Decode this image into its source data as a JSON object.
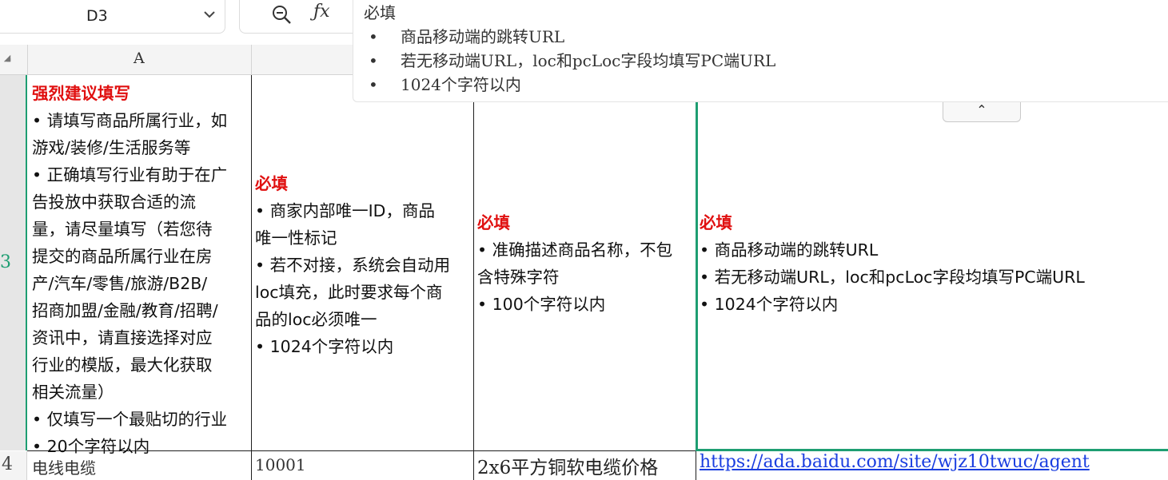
{
  "name_box": {
    "value": "D3"
  },
  "formula_bar": {
    "title": "必填",
    "bullets": [
      "商品移动端的跳转URL",
      "若无移动端URL，loc和pcLoc字段均填写PC端URL",
      "1024个字符以内"
    ],
    "collapse_glyph": "⌃"
  },
  "columns": {
    "a_label": "A"
  },
  "rows": {
    "row3_label": "3",
    "row4_label": "4"
  },
  "row3": {
    "a": {
      "title": "强烈建议填写",
      "lines": [
        "• 请填写商品所属行业，如",
        "游戏/装修/生活服务等",
        "• 正确填写行业有助于在广",
        "告投放中获取合适的流",
        "量，请尽量填写（若您待",
        "提交的商品所属行业在房",
        "产/汽车/零售/旅游/B2B/",
        "招商加盟/金融/教育/招聘/",
        "资讯中，请直接选择对应",
        "行业的模版，最大化获取",
        "相关流量）",
        "• 仅填写一个最贴切的行业",
        "• 20个字符以内"
      ]
    },
    "b": {
      "title": "必填",
      "lines": [
        "• 商家内部唯一ID，商品",
        "唯一性标记",
        "• 若不对接，系统会自动用",
        "loc填充，此时要求每个商",
        "品的loc必须唯一",
        "• 1024个字符以内"
      ]
    },
    "c": {
      "title": "必填",
      "lines": [
        "• 准确描述商品名称，不包",
        "含特殊字符",
        "• 100个字符以内"
      ]
    },
    "d": {
      "title": "必填",
      "lines": [
        "• 商品移动端的跳转URL",
        "• 若无移动端URL，loc和pcLoc字段均填写PC端URL",
        "• 1024个字符以内"
      ]
    }
  },
  "row4": {
    "a": "电线电缆",
    "b": "10001",
    "c": "2x6平方铜软电缆价格",
    "d": "https://ada.baidu.com/site/wjz10twuc/agent"
  },
  "colors": {
    "accent": "#1e9e72",
    "required_red": "#e01010",
    "link": "#1a3ee0"
  }
}
